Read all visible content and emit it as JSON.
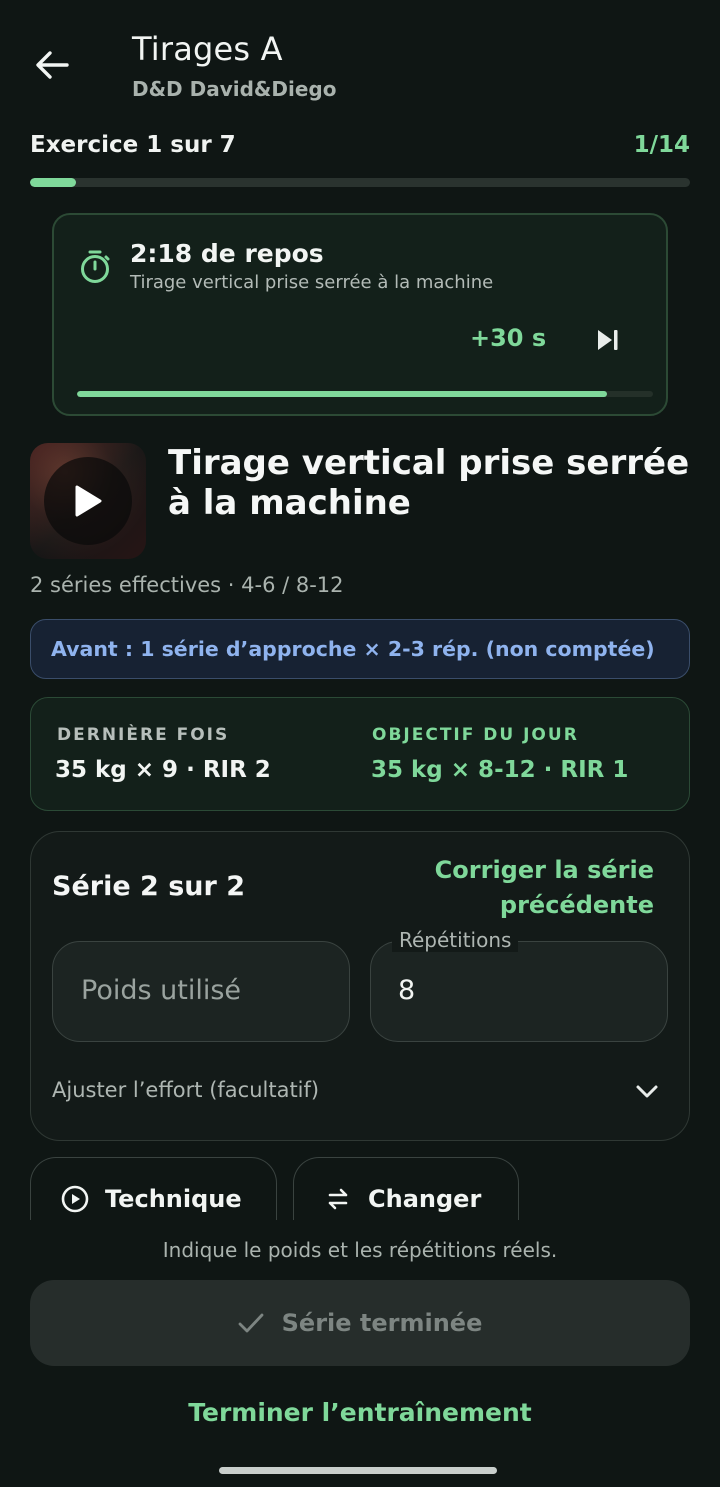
{
  "header": {
    "title": "Tirages A",
    "subtitle": "D&D David&Diego"
  },
  "progress": {
    "exercise_label": "Exercice 1 sur 7",
    "set_label": "1/14",
    "fraction": 0.07
  },
  "rest": {
    "time_label": "2:18 de repos",
    "exercise_name": "Tirage vertical prise serrée à la machine",
    "add_time_label": "+30 s",
    "fraction": 0.92
  },
  "exercise": {
    "title": "Tirage vertical prise serrée à la machine",
    "meta": "2 séries effectives · 4-6 / 8-12",
    "warmup": "Avant : 1 série d’approche × 2-3 rép. (non comptée)"
  },
  "history": {
    "last_label": "DERNIÈRE FOIS",
    "last_value": "35 kg × 9 · RIR 2",
    "target_label": "OBJECTIF DU JOUR",
    "target_value": "35 kg × 8-12 · RIR 1"
  },
  "set": {
    "title": "Série 2 sur 2",
    "fix_previous": "Corriger la série précédente",
    "weight_placeholder": "Poids utilisé",
    "reps_label": "Répétitions",
    "reps_value": "8",
    "effort_label": "Ajuster l’effort (facultatif)"
  },
  "actions": {
    "technique": "Technique",
    "change": "Changer"
  },
  "footer": {
    "hint": "Indique le poids et les répétitions réels.",
    "done_label": "Série terminée",
    "finish_label": "Terminer l’entraînement"
  },
  "colors": {
    "accent": "#7fd89a",
    "background": "#0f1614",
    "warmup_text": "#8fb3ee"
  },
  "icons": {
    "back": "arrow-left-icon",
    "timer": "stopwatch-icon",
    "skip": "skip-next-icon",
    "play": "play-icon",
    "chevron": "chevron-down-icon",
    "technique": "play-circle-icon",
    "change": "swap-icon",
    "check": "check-icon"
  }
}
